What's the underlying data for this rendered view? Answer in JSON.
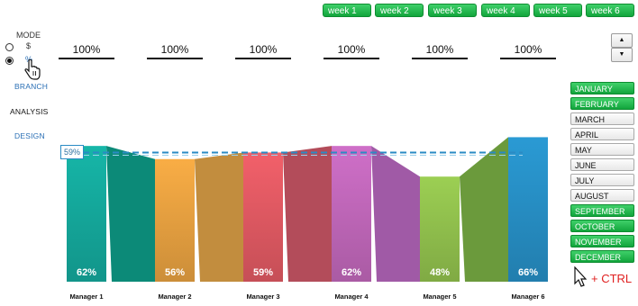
{
  "weeks": [
    "week 1",
    "week 2",
    "week 3",
    "week 4",
    "week 5",
    "week 6"
  ],
  "mode": {
    "label": "MODE",
    "options": [
      {
        "label": "$",
        "selected": false
      },
      {
        "label": "%",
        "selected": true
      }
    ]
  },
  "nav": {
    "branch": "BRANCH",
    "analysis": "ANALYSIS",
    "design": "DESIGN"
  },
  "percent_inputs": [
    "100%",
    "100%",
    "100%",
    "100%",
    "100%",
    "100%"
  ],
  "months": [
    {
      "label": "JANUARY",
      "selected": true
    },
    {
      "label": "FEBRUARY",
      "selected": true
    },
    {
      "label": "MARCH",
      "selected": false
    },
    {
      "label": "APRIL",
      "selected": false
    },
    {
      "label": "MAY",
      "selected": false
    },
    {
      "label": "JUNE",
      "selected": false
    },
    {
      "label": "JULY",
      "selected": false
    },
    {
      "label": "AUGUST",
      "selected": false
    },
    {
      "label": "SEPTEMBER",
      "selected": true
    },
    {
      "label": "OCTOBER",
      "selected": true
    },
    {
      "label": "NOVEMBER",
      "selected": true
    },
    {
      "label": "DECEMBER",
      "selected": true
    }
  ],
  "ctrl_hint": "+ CTRL",
  "chart_data": {
    "type": "bar",
    "categories": [
      "Manager 1",
      "Manager 2",
      "Manager 3",
      "Manager 4",
      "Manager 5",
      "Manager 6"
    ],
    "values": [
      62,
      56,
      59,
      62,
      48,
      66
    ],
    "value_labels": [
      "62%",
      "56%",
      "59%",
      "62%",
      "48%",
      "66%"
    ],
    "average": 59,
    "average_label": "59%",
    "colors": [
      "#16b6a8",
      "#f9ad45",
      "#f2606a",
      "#cf6fc8",
      "#9ccf53",
      "#2a9ad4"
    ],
    "ribbon_colors": [
      "#0c8a78",
      "#c28d3e",
      "#b34c5a",
      "#a05aa6",
      "#6b9a3c"
    ],
    "average_line_color": "#2a8bc4",
    "ylim": [
      0,
      70
    ]
  }
}
